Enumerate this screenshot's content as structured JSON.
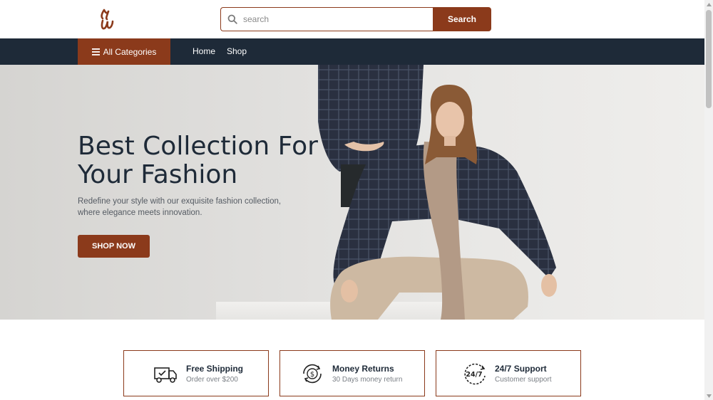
{
  "header": {
    "logo_icon": "script-logo-icon",
    "search": {
      "placeholder": "search",
      "value": "",
      "button_label": "Search",
      "icon": "search-icon"
    }
  },
  "nav": {
    "categories_label": "All Categories",
    "categories_icon": "hamburger-icon",
    "links": [
      "Home",
      "Shop"
    ]
  },
  "hero": {
    "title": "Best Collection For Your Fashion",
    "subtitle": "Redefine your style with our exquisite fashion collection, where elegance meets innovation.",
    "cta_label": "SHOP NOW"
  },
  "features": [
    {
      "icon": "delivery-truck-icon",
      "title": "Free Shipping",
      "subtitle": "Order over $200"
    },
    {
      "icon": "money-return-icon",
      "title": "Money Returns",
      "subtitle": "30 Days money return"
    },
    {
      "icon": "support-24-7-icon",
      "title": "24/7 Support",
      "subtitle": "Customer support"
    }
  ],
  "colors": {
    "brand": "#8b3a1b",
    "navy": "#1e2a38",
    "hero_bg": "#e3e2e0"
  }
}
